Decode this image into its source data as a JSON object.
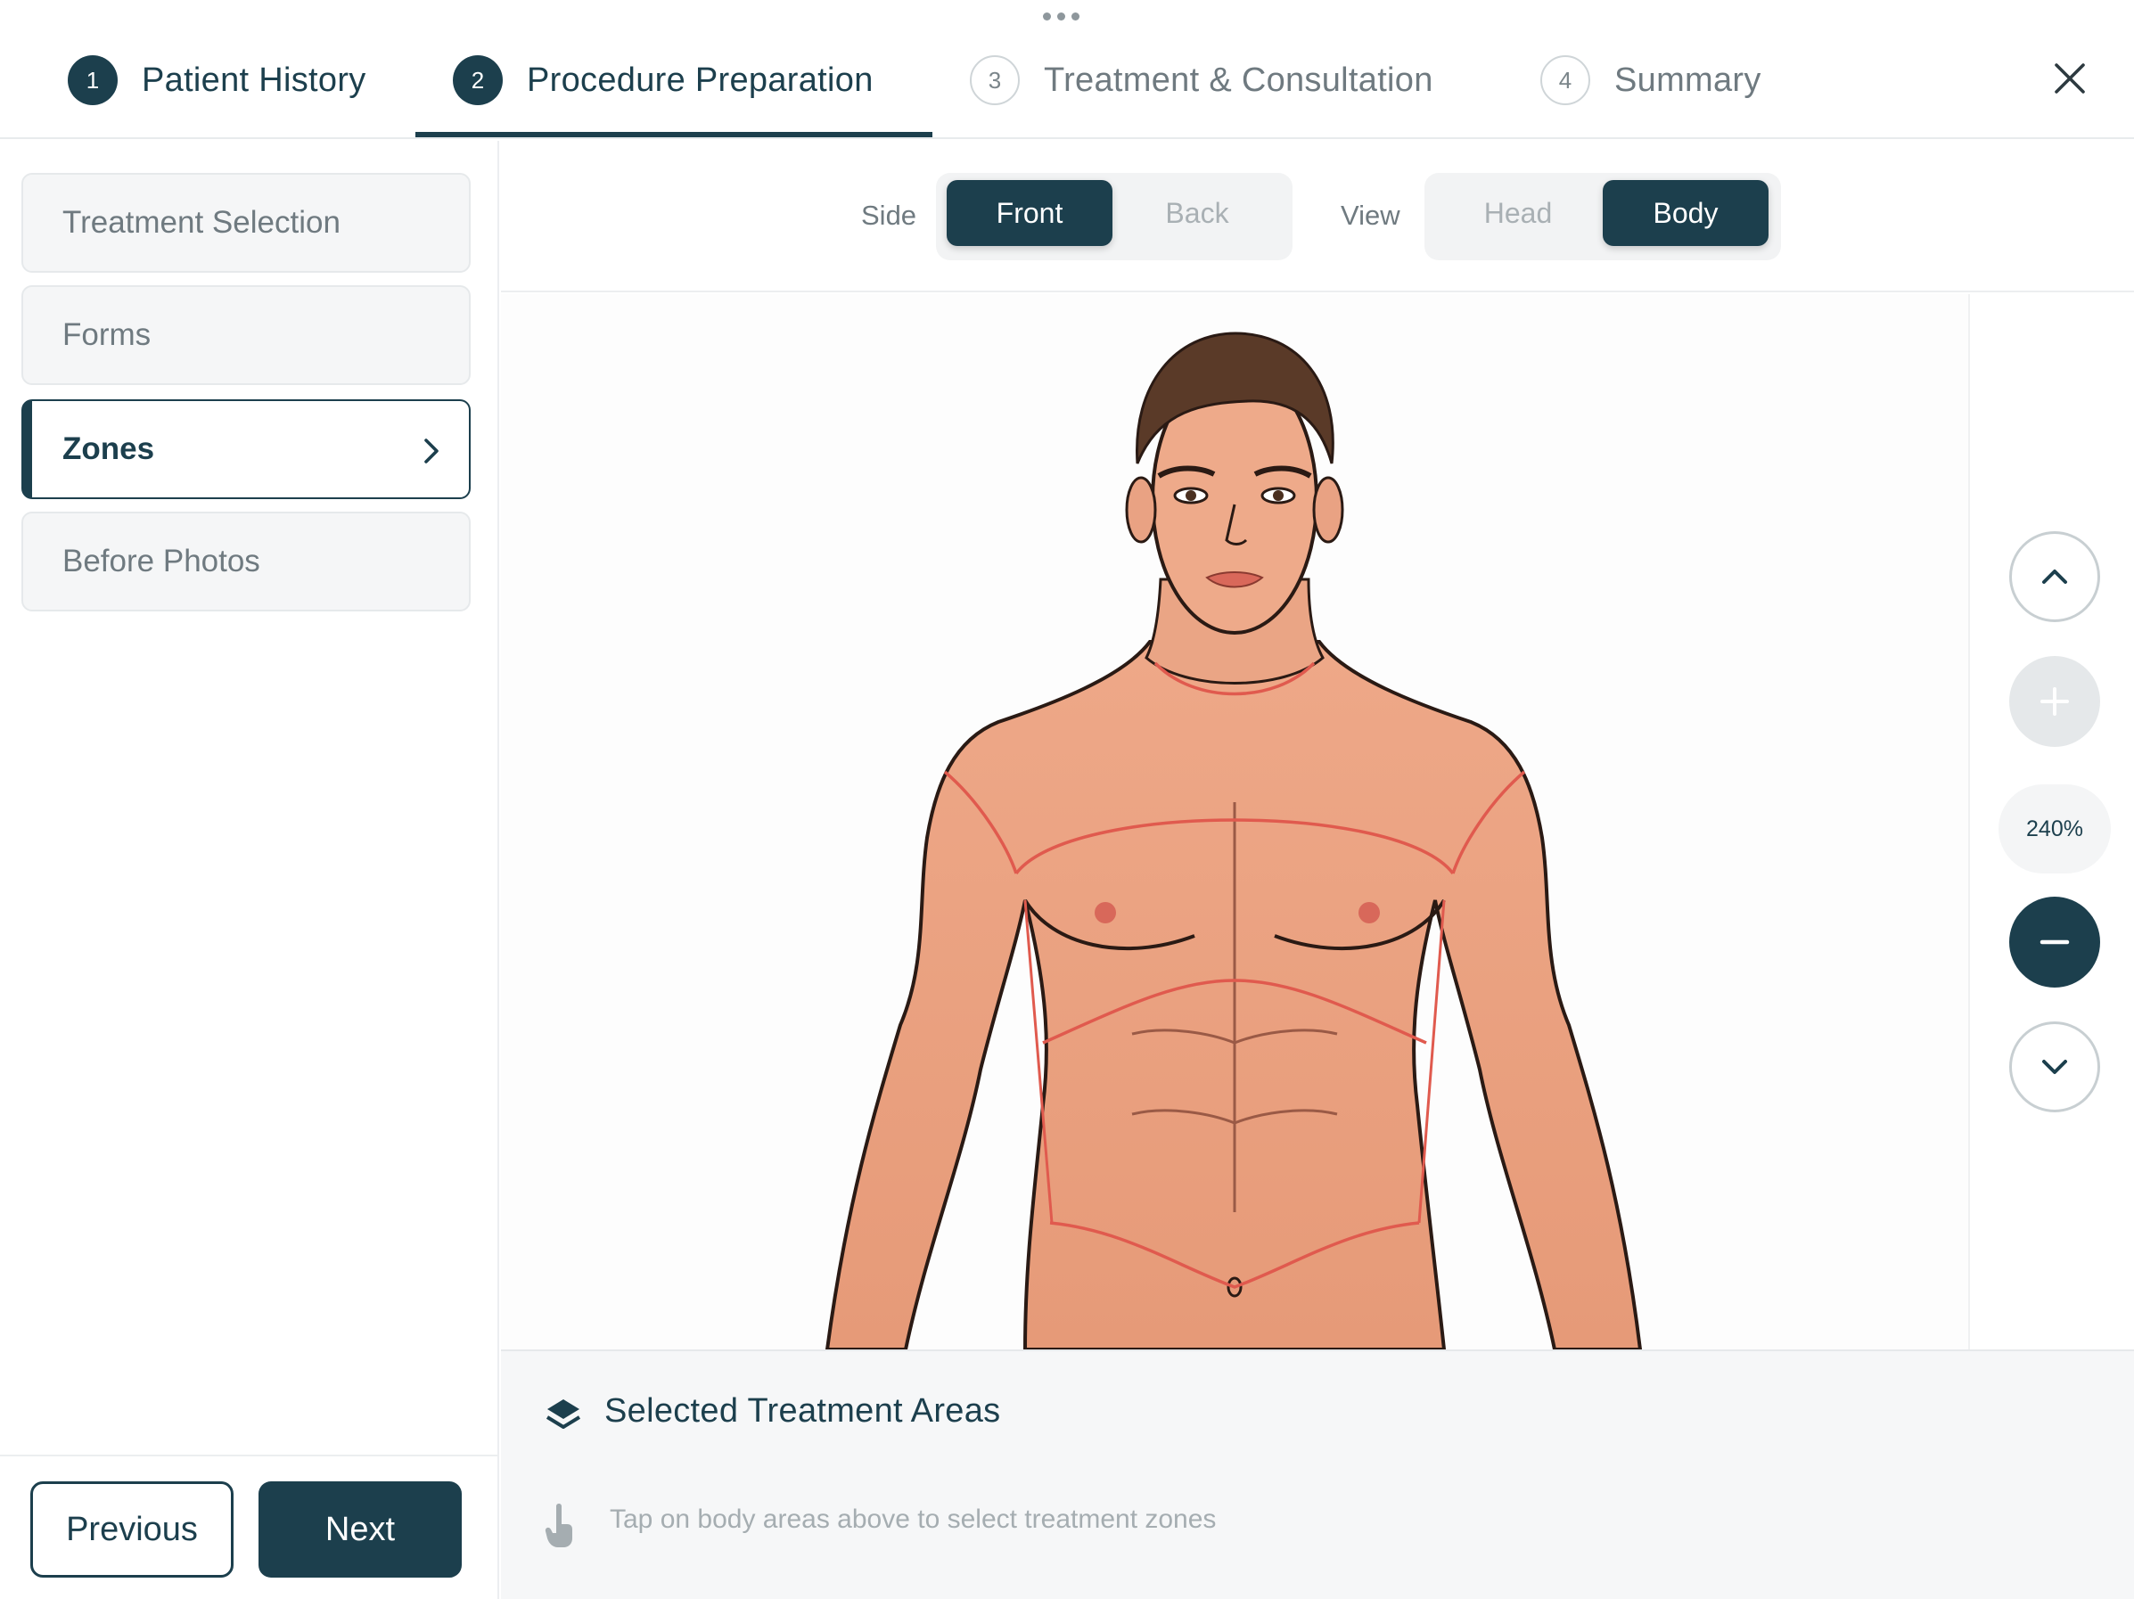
{
  "stepper": {
    "steps": [
      {
        "number": "1",
        "label": "Patient History"
      },
      {
        "number": "2",
        "label": "Procedure Preparation"
      },
      {
        "number": "3",
        "label": "Treatment & Consultation"
      },
      {
        "number": "4",
        "label": "Summary"
      }
    ],
    "active_step": "2"
  },
  "sidebar": {
    "items": [
      {
        "label": "Treatment Selection"
      },
      {
        "label": "Forms"
      },
      {
        "label": "Zones"
      },
      {
        "label": "Before Photos"
      }
    ],
    "active_item": "Zones",
    "previous_label": "Previous",
    "next_label": "Next"
  },
  "toolbar": {
    "side_label": "Side",
    "side_options": [
      "Front",
      "Back"
    ],
    "side_selected": "Front",
    "view_label": "View",
    "view_options": [
      "Head",
      "Body"
    ],
    "view_selected": "Body"
  },
  "zoom": {
    "level": "240%"
  },
  "selected_areas": {
    "title": "Selected Treatment Areas",
    "hint": "Tap on body areas above to select treatment zones"
  },
  "colors": {
    "primary": "#1c3f4d",
    "skin": "#eaa080",
    "zone_line": "#e05a4e"
  },
  "icons": {
    "close": "close-icon",
    "chevron": "chevron-right-icon",
    "layers": "layers-icon",
    "tap": "hand-tap-icon",
    "zoom_in": "plus-icon",
    "zoom_out": "minus-icon",
    "pan_up": "chevron-up-icon",
    "pan_down": "chevron-down-icon"
  }
}
